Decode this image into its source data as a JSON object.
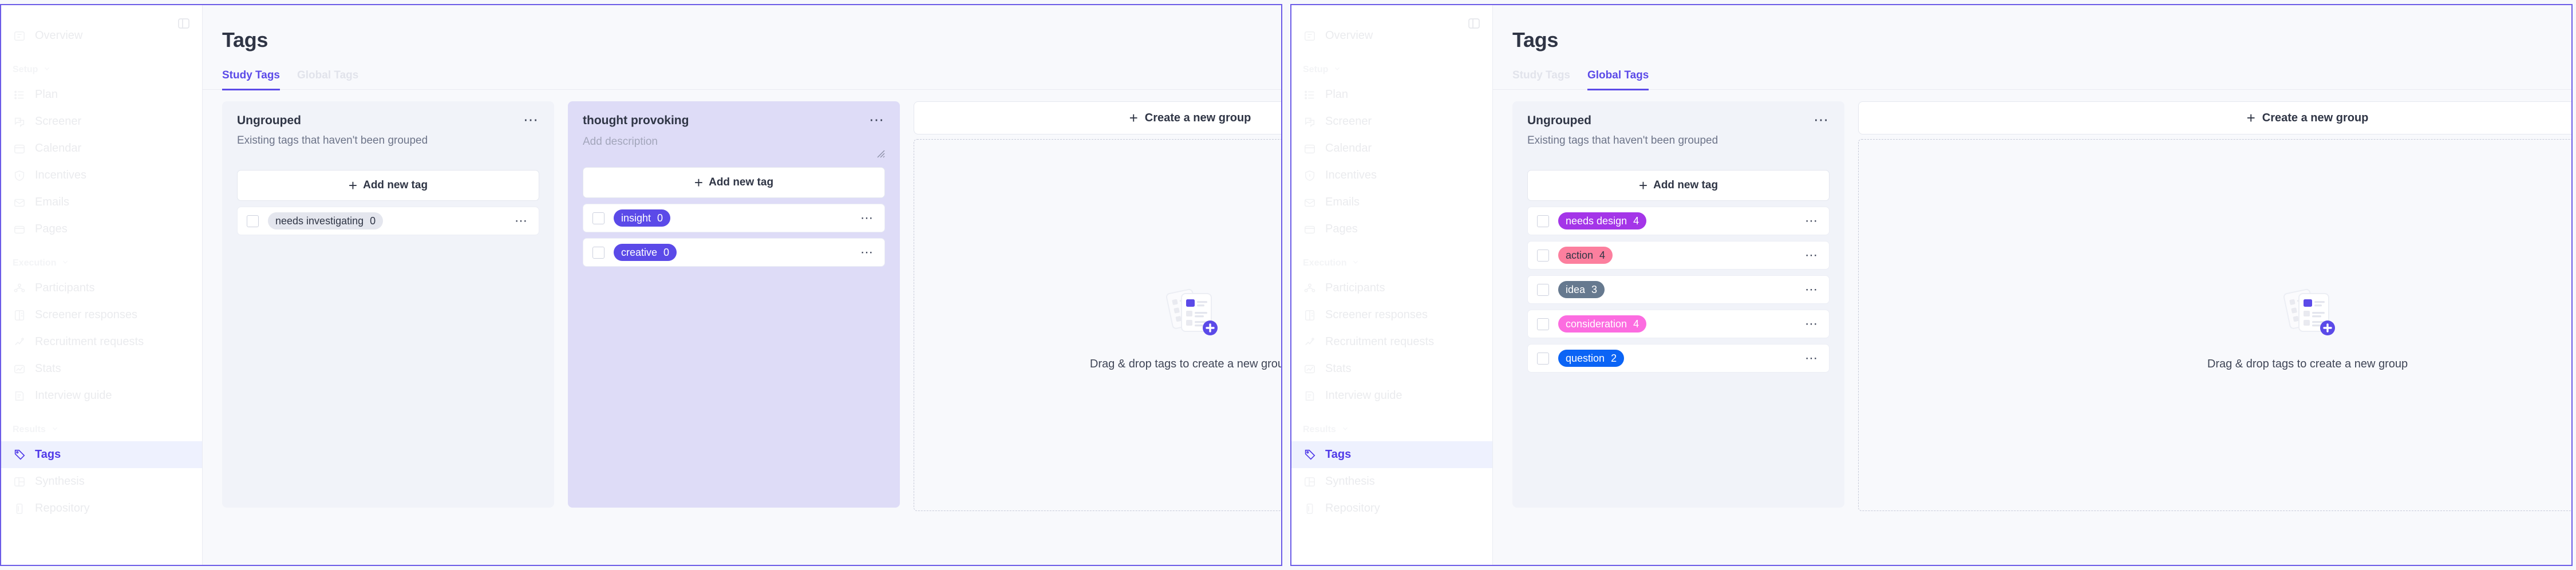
{
  "accent": "#5b4ae8",
  "sidebar": {
    "collapse_icon": "panel-collapse-icon",
    "top_items": [
      {
        "label": "Overview",
        "icon": "overview-icon"
      }
    ],
    "groups": [
      {
        "label": "Setup",
        "items": [
          {
            "label": "Plan",
            "icon": "plan-icon"
          },
          {
            "label": "Screener",
            "icon": "screener-icon"
          },
          {
            "label": "Calendar",
            "icon": "calendar-icon"
          },
          {
            "label": "Incentives",
            "icon": "incentives-icon"
          },
          {
            "label": "Emails",
            "icon": "emails-icon"
          },
          {
            "label": "Pages",
            "icon": "pages-icon"
          }
        ]
      },
      {
        "label": "Execution",
        "items": [
          {
            "label": "Participants",
            "icon": "participants-icon"
          },
          {
            "label": "Screener responses",
            "icon": "screener-responses-icon"
          },
          {
            "label": "Recruitment requests",
            "icon": "recruitment-requests-icon"
          },
          {
            "label": "Stats",
            "icon": "stats-icon"
          },
          {
            "label": "Interview guide",
            "icon": "interview-guide-icon"
          }
        ]
      },
      {
        "label": "Results",
        "items": [
          {
            "label": "Tags",
            "icon": "tag-icon",
            "active": true
          },
          {
            "label": "Synthesis",
            "icon": "synthesis-icon"
          },
          {
            "label": "Repository",
            "icon": "repository-icon"
          }
        ]
      }
    ]
  },
  "left_panel": {
    "title": "Tags",
    "tabs": [
      {
        "label": "Study Tags",
        "active": true
      },
      {
        "label": "Global Tags",
        "active": false
      }
    ],
    "groups": [
      {
        "name": "Ungrouped",
        "subtitle": "Existing tags that haven't been grouped",
        "add_tag_label": "Add new tag",
        "menu_icon": "more-options-icon",
        "tags": [
          {
            "label": "needs investigating",
            "count": "0",
            "bg": "#e4e6ee",
            "fg": "#2f3545"
          }
        ]
      },
      {
        "name": "thought provoking",
        "description_placeholder": "Add description",
        "add_tag_label": "Add new tag",
        "menu_icon": "more-options-icon",
        "resize_icon": "resize-grip-icon",
        "tags": [
          {
            "label": "insight",
            "count": "0",
            "bg": "#5b4ae8",
            "fg": "#ffffff"
          },
          {
            "label": "creative",
            "count": "0",
            "bg": "#5b4ae8",
            "fg": "#ffffff"
          }
        ]
      }
    ],
    "create_group_label": "Create a new group",
    "dropzone_text": "Drag & drop tags to create a new group",
    "dropzone_icon": "new-group-illustration"
  },
  "right_panel": {
    "title": "Tags",
    "tabs": [
      {
        "label": "Study Tags",
        "active": false
      },
      {
        "label": "Global Tags",
        "active": true
      }
    ],
    "groups": [
      {
        "name": "Ungrouped",
        "subtitle": "Existing tags that haven't been grouped",
        "add_tag_label": "Add new tag",
        "menu_icon": "more-options-icon",
        "tags": [
          {
            "label": "needs design",
            "count": "4",
            "bg": "#a435e8",
            "fg": "#ffffff"
          },
          {
            "label": "action",
            "count": "4",
            "bg": "#fc7f9e",
            "fg": "#2f3545"
          },
          {
            "label": "idea",
            "count": "3",
            "bg": "#66798f",
            "fg": "#ffffff"
          },
          {
            "label": "consideration",
            "count": "4",
            "bg": "#fc6ce0",
            "fg": "#ffffff"
          },
          {
            "label": "question",
            "count": "2",
            "bg": "#0b64f5",
            "fg": "#ffffff"
          }
        ]
      }
    ],
    "create_group_label": "Create a new group",
    "dropzone_text": "Drag & drop tags to create a new group",
    "dropzone_icon": "new-group-illustration"
  }
}
